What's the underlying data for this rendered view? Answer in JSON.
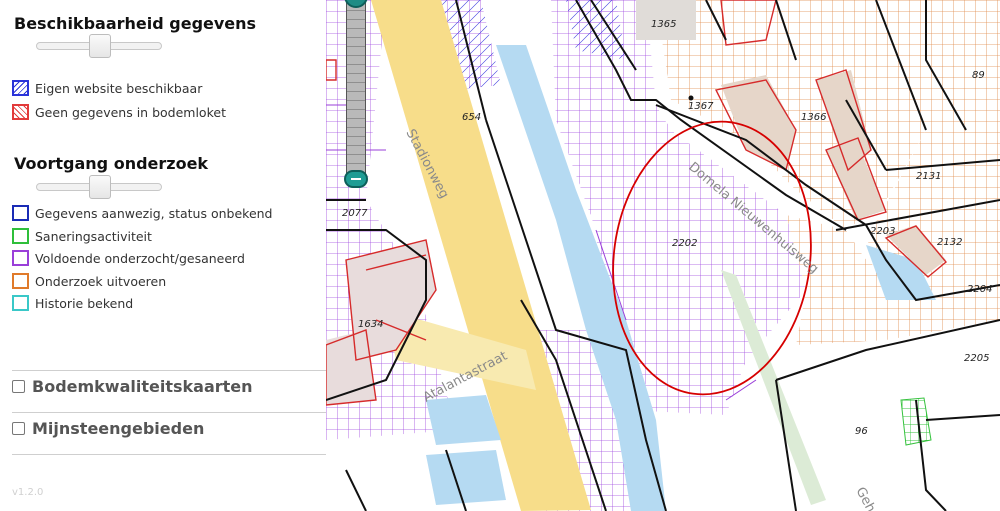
{
  "panel": {
    "beschikbaarheid": {
      "title": "Beschikbaarheid gegevens",
      "legend": [
        {
          "label": "Eigen website beschikbaar",
          "color": "#2a33d9"
        },
        {
          "label": "Geen gegevens in bodemloket",
          "color": "#e23a3a"
        }
      ]
    },
    "voortgang": {
      "title": "Voortgang onderzoek",
      "legend": [
        {
          "label": "Gegevens aanwezig, status onbekend",
          "color": "#1a2bb5"
        },
        {
          "label": "Saneringsactiviteit",
          "color": "#2fbf3a"
        },
        {
          "label": "Voldoende onderzocht/gesaneerd",
          "color": "#9a3fd9"
        },
        {
          "label": "Onderzoek uitvoeren",
          "color": "#e07a2a"
        },
        {
          "label": "Historie bekend",
          "color": "#3ac8c8"
        }
      ]
    },
    "layers": [
      {
        "label": "Bodemkwaliteitskaarten",
        "checked": false
      },
      {
        "label": "Mijnsteengebieden",
        "checked": false
      }
    ],
    "version": "v1.2.0"
  },
  "map": {
    "parcels": [
      "1365",
      "89",
      "1367",
      "1366",
      "654",
      "2131",
      "2077",
      "2202",
      "2203",
      "2132",
      "2204",
      "1634",
      "2205",
      "96"
    ],
    "streets": [
      "Stadionweg",
      "Domela Nieuwenhuisweg",
      "Atalantastraat",
      "Geh"
    ]
  },
  "icons": {
    "zoom_slider": "zoom-slider-icon",
    "hatch_blue": "hatch-swatch-icon",
    "hatch_red": "hatch-swatch-icon"
  }
}
